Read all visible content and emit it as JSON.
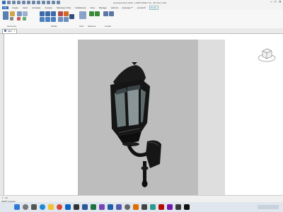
{
  "window": {
    "title": "Autodesk Revit 2020 - LAMP FAMILY.rfa - 3D View: {3D}",
    "controls": [
      "–",
      "□",
      "✕"
    ]
  },
  "ribbon": {
    "tabs": [
      "File",
      "Create",
      "Insert",
      "Annotate",
      "Analyze",
      "Massing & Site",
      "Collaborate",
      "View",
      "Manage",
      "Add-Ins",
      "Enscape™",
      "Lumion®",
      "Modify"
    ],
    "active_tab": "Modify",
    "panels": [
      "Geometry",
      "Modify",
      "View",
      "Measure",
      "Create"
    ]
  },
  "view_tab": {
    "label": "{3D}",
    "close": "×"
  },
  "statusbar": {
    "scale": "1 : 10",
    "message": "3D/PT preview"
  },
  "colors": {
    "accent": "#1a4f9c",
    "sheet": "#bdbdbd",
    "lamp": "#1a1a1a"
  },
  "taskbar": {
    "icons": [
      "windows-icon",
      "search-icon",
      "task-view-icon",
      "edge-icon",
      "explorer-icon",
      "chrome-icon",
      "mail-icon",
      "store-icon",
      "word-icon",
      "excel-icon",
      "photos-icon",
      "revit-icon",
      "teams-icon",
      "settings-icon",
      "media-icon",
      "camera-icon",
      "maps-icon",
      "acrobat-icon",
      "onenote-icon",
      "calc-icon",
      "terminal-icon"
    ]
  }
}
